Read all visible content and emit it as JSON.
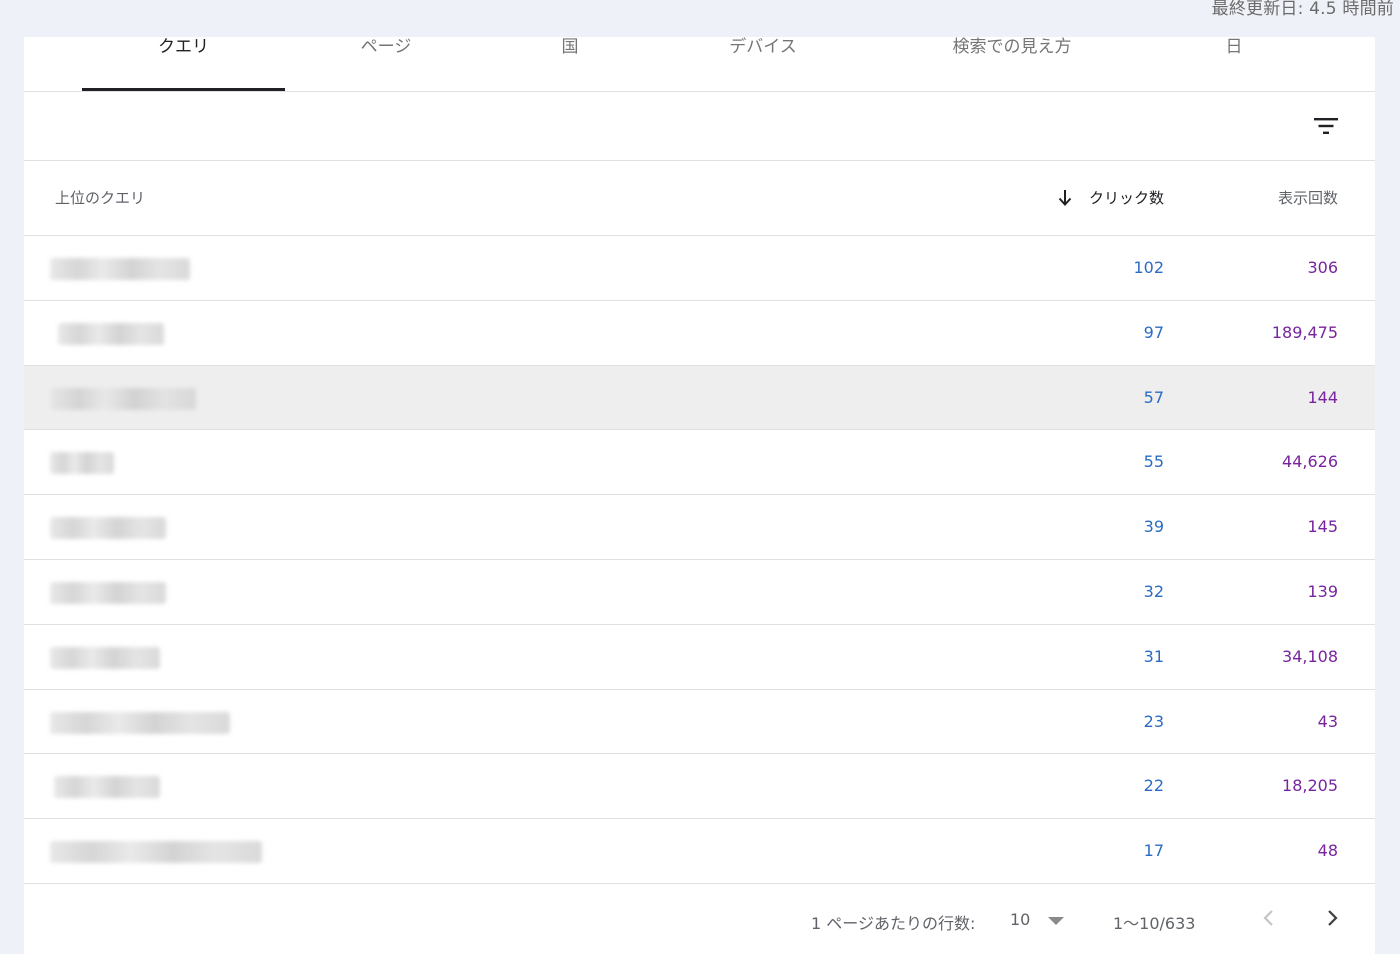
{
  "header": {
    "last_updated": "最終更新日: 4.5 時間前"
  },
  "tabs": [
    {
      "label": "クエリ",
      "active": true
    },
    {
      "label": "ページ",
      "active": false
    },
    {
      "label": "国",
      "active": false
    },
    {
      "label": "デバイス",
      "active": false
    },
    {
      "label": "検索での見え方",
      "active": false
    },
    {
      "label": "日",
      "active": false
    }
  ],
  "toolbar": {
    "filter_icon": "filter-list-icon"
  },
  "table": {
    "columns": {
      "query": "上位のクエリ",
      "clicks": "クリック数",
      "impressions": "表示回数"
    },
    "sort_icon": "arrow-downward-icon",
    "rows": [
      {
        "query": "",
        "clicks": "102",
        "impressions": "306",
        "highlighted": false
      },
      {
        "query": "",
        "clicks": "97",
        "impressions": "189,475",
        "highlighted": false
      },
      {
        "query": "",
        "clicks": "57",
        "impressions": "144",
        "highlighted": true
      },
      {
        "query": "",
        "clicks": "55",
        "impressions": "44,626",
        "highlighted": false
      },
      {
        "query": "",
        "clicks": "39",
        "impressions": "145",
        "highlighted": false
      },
      {
        "query": "",
        "clicks": "32",
        "impressions": "139",
        "highlighted": false
      },
      {
        "query": "",
        "clicks": "31",
        "impressions": "34,108",
        "highlighted": false
      },
      {
        "query": "",
        "clicks": "23",
        "impressions": "43",
        "highlighted": false
      },
      {
        "query": "",
        "clicks": "22",
        "impressions": "18,205",
        "highlighted": false
      },
      {
        "query": "",
        "clicks": "17",
        "impressions": "48",
        "highlighted": false
      }
    ]
  },
  "pagination": {
    "rows_per_page_label": "1 ページあたりの行数:",
    "rows_per_page_value": "10",
    "range": "1〜10/633",
    "prev_icon": "chevron-left-icon",
    "next_icon": "chevron-right-icon"
  },
  "colors": {
    "clicks": "#2a6cc4",
    "impressions": "#78249f",
    "background": "#eef1f7",
    "highlight_row": "#eeeeee"
  }
}
